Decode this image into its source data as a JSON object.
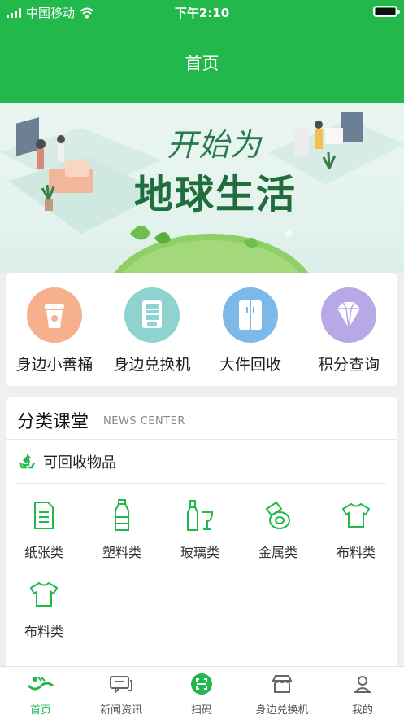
{
  "status_bar": {
    "carrier": "中国移动",
    "time": "下午2:10"
  },
  "header": {
    "title": "首页"
  },
  "banner": {
    "line1": "开始为",
    "line2": "地球生活"
  },
  "shortcuts": [
    {
      "label": "身边小善桶",
      "icon": "trash-bin-icon",
      "color": "#f6b08c"
    },
    {
      "label": "身边兑换机",
      "icon": "exchange-machine-icon",
      "color": "#8fd3d1"
    },
    {
      "label": "大件回收",
      "icon": "refrigerator-icon",
      "color": "#7cb8e8"
    },
    {
      "label": "积分查询",
      "icon": "diamond-icon",
      "color": "#b7a9e6"
    }
  ],
  "classroom": {
    "title": "分类课堂",
    "subtitle": "NEWS CENTER",
    "section_label": "可回收物品",
    "categories": [
      {
        "label": "纸张类",
        "icon": "paper-icon"
      },
      {
        "label": "塑料类",
        "icon": "plastic-bottle-icon"
      },
      {
        "label": "玻璃类",
        "icon": "glass-bottle-icon"
      },
      {
        "label": "金属类",
        "icon": "metal-can-icon"
      },
      {
        "label": "布料类",
        "icon": "tshirt-icon"
      },
      {
        "label": "布料类",
        "icon": "tshirt-icon"
      }
    ]
  },
  "tabbar": [
    {
      "label": "首页",
      "icon": "home-icon",
      "active": true
    },
    {
      "label": "新闻资讯",
      "icon": "news-icon",
      "active": false
    },
    {
      "label": "扫码",
      "icon": "scan-icon",
      "active": false
    },
    {
      "label": "身边兑换机",
      "icon": "shop-icon",
      "active": false
    },
    {
      "label": "我的",
      "icon": "user-icon",
      "active": false
    }
  ],
  "colors": {
    "brand": "#22b84c",
    "background": "#efefef"
  }
}
